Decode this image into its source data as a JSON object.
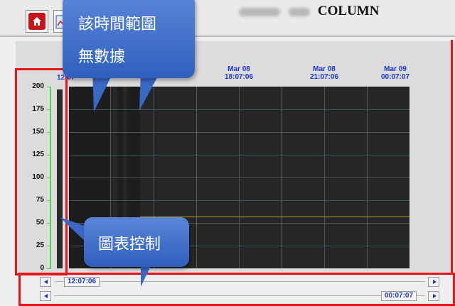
{
  "header": {
    "title": "COLUMN",
    "home_icon": "home-icon",
    "chart_icon": "chart-icon"
  },
  "chart_data": {
    "type": "line",
    "y_ticks": [
      "200",
      "175",
      "150",
      "125",
      "100",
      "75",
      "50",
      "25",
      "0"
    ],
    "ylim": [
      0,
      200
    ],
    "x_ticks": [
      {
        "date": "12:07",
        "time": ""
      },
      {
        "date": "Mar 08",
        "time": "18:07:06"
      },
      {
        "date": "Mar 08",
        "time": "21:07:06"
      },
      {
        "date": "Mar 09",
        "time": "00:07:07"
      }
    ],
    "series": [
      {
        "color": "#c8a020",
        "values": [
          57,
          57
        ]
      }
    ],
    "grid": true
  },
  "scrollbars": {
    "top_label": "12:07:06",
    "bottom_label": "00:07:07"
  },
  "annotations": {
    "no_data_line1": "該時間範圍",
    "no_data_line2": "無數據",
    "chart_control": "圖表控制"
  },
  "colors": {
    "highlight": "#e8141c",
    "callout": "#3f6fcc",
    "axis_text": "#1a33d8"
  }
}
